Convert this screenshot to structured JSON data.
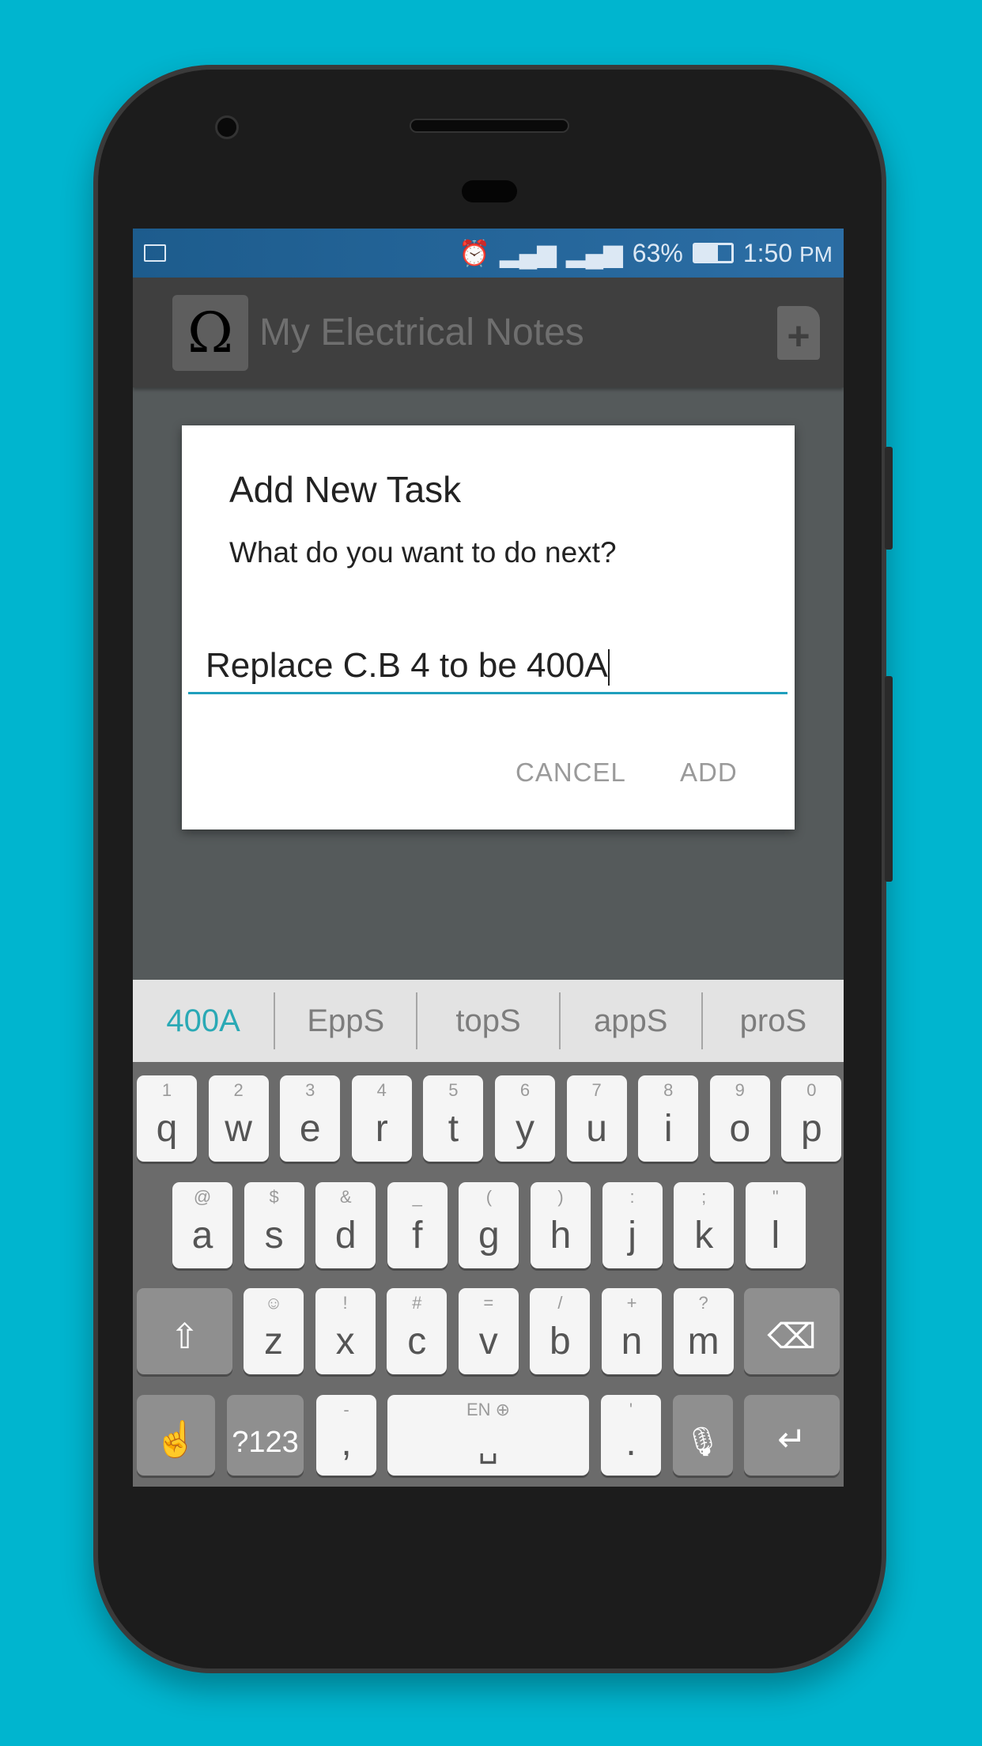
{
  "status_bar": {
    "battery": "63%",
    "time": "1:50",
    "ampm": "PM",
    "icons": [
      "notification-icon",
      "alarm-icon",
      "signal-icon",
      "signal-icon",
      "battery-icon"
    ]
  },
  "app_bar": {
    "logo_glyph": "Ω",
    "title": "My Electrical Notes",
    "action_icon": "add-note-icon"
  },
  "dialog": {
    "title": "Add New Task",
    "message": "What do you want to do next?",
    "input_value": "Replace C.B 4 to be 400A",
    "cancel_label": "CANCEL",
    "add_label": "ADD",
    "accent_color": "#1f9fbd"
  },
  "keyboard": {
    "suggestions": [
      "400A",
      "EppS",
      "topS",
      "appS",
      "proS"
    ],
    "row1": [
      {
        "k": "q",
        "h": "1"
      },
      {
        "k": "w",
        "h": "2"
      },
      {
        "k": "e",
        "h": "3"
      },
      {
        "k": "r",
        "h": "4"
      },
      {
        "k": "t",
        "h": "5"
      },
      {
        "k": "y",
        "h": "6"
      },
      {
        "k": "u",
        "h": "7"
      },
      {
        "k": "i",
        "h": "8"
      },
      {
        "k": "o",
        "h": "9"
      },
      {
        "k": "p",
        "h": "0"
      }
    ],
    "row2": [
      {
        "k": "a",
        "h": "@"
      },
      {
        "k": "s",
        "h": "$"
      },
      {
        "k": "d",
        "h": "&"
      },
      {
        "k": "f",
        "h": "_"
      },
      {
        "k": "g",
        "h": "("
      },
      {
        "k": "h",
        "h": ")"
      },
      {
        "k": "j",
        "h": ":"
      },
      {
        "k": "k",
        "h": ";"
      },
      {
        "k": "l",
        "h": "\""
      }
    ],
    "row3": [
      {
        "k": "z",
        "h": "☺"
      },
      {
        "k": "x",
        "h": "!"
      },
      {
        "k": "c",
        "h": "#"
      },
      {
        "k": "v",
        "h": "="
      },
      {
        "k": "b",
        "h": "/"
      },
      {
        "k": "n",
        "h": "+"
      },
      {
        "k": "m",
        "h": "?"
      }
    ],
    "shift": "⇧",
    "backspace": "⌫",
    "gesture": "☝",
    "symbols": "?123",
    "comma": ",",
    "comma_hint": "-",
    "space_hint": "EN ⊕",
    "space": "␣",
    "period": ".",
    "period_hint": "'",
    "mic": "🎙",
    "enter": "↵"
  }
}
